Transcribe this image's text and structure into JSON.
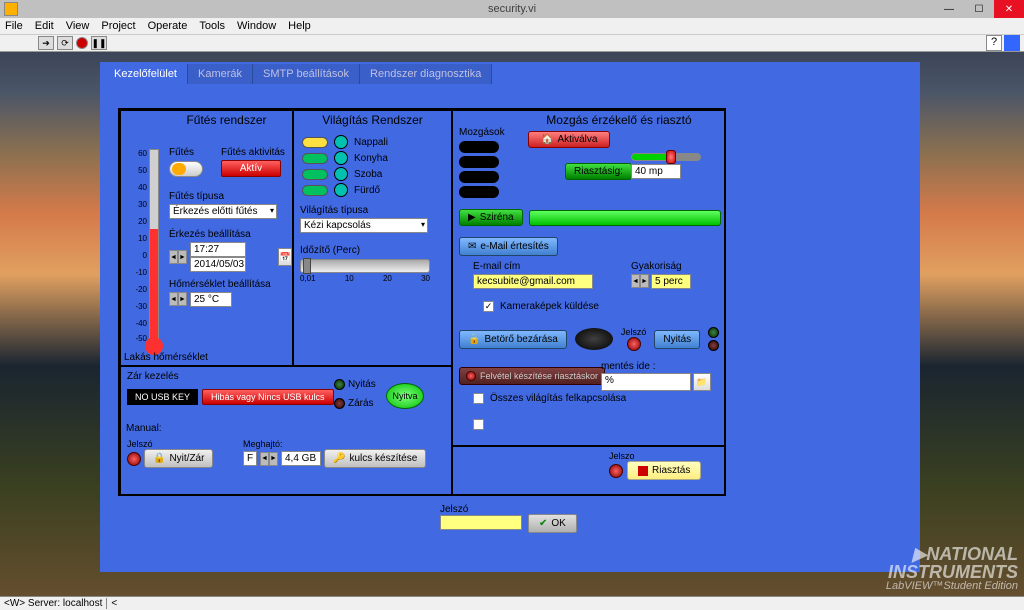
{
  "window": {
    "title": "security.vi"
  },
  "menu": [
    "File",
    "Edit",
    "View",
    "Project",
    "Operate",
    "Tools",
    "Window",
    "Help"
  ],
  "tabs": [
    "Kezelőfelület",
    "Kamerák",
    "SMTP beállítások",
    "Rendszer diagnosztika"
  ],
  "heating": {
    "title": "Fűtés rendszer",
    "futes_label": "Fűtés",
    "aktivitas_label": "Fűtés aktivitás",
    "aktiv": "Aktív",
    "tipus_label": "Fűtés típusa",
    "tipus_value": "Érkezés előtti fűtés",
    "erkezes_label": "Érkezés beállítása",
    "erkezes_time": "17:27",
    "erkezes_date": "2014/05/03",
    "temp_label": "Hőmérséklet beállítása",
    "temp_value": "25 °C",
    "bottom_label": "Lakás hőmérséklet",
    "ticks": [
      "60",
      "50",
      "40",
      "30",
      "20",
      "10",
      "0",
      "-10",
      "-20",
      "-30",
      "-40",
      "-50"
    ]
  },
  "lighting": {
    "title": "Világítás Rendszer",
    "rooms": [
      "Nappali",
      "Konyha",
      "Szoba",
      "Fürdő"
    ],
    "colors": [
      "#ffe040",
      "#00c060",
      "#00c060",
      "#00c060"
    ],
    "led_colors": [
      "#00c0b0",
      "#00c0b0",
      "#00c0b0",
      "#00c0b0"
    ],
    "tipus_label": "Világítás típusa",
    "tipus_value": "Kézi kapcsolás",
    "timer_label": "Időzítő (Perc)",
    "timer_ticks": [
      "0,01",
      "10",
      "20",
      "30"
    ]
  },
  "motion": {
    "title": "Mozgás érzékelő és riasztó",
    "mozgasok": "Mozgások",
    "aktivalva": "Aktiválva",
    "riasztasig": "Riasztásig:",
    "riaszt_val": "40 mp",
    "sziren": "Sziréna",
    "email_btn": "e-Mail értesítés",
    "email_label": "E-mail cím",
    "email_value": "kecsubite@gmail.com",
    "gyak_label": "Gyakoriság",
    "gyak_value": "5 perc",
    "kamerak": "Kameraképek küldése",
    "betoro": "Betörő bezárása",
    "jelszo": "Jelszó",
    "nyitas": "Nyitás",
    "felvetel": "Felvétel készítése riasztáskor",
    "mentes_label": "mentés ide :",
    "mentes_value": "%",
    "osszes": "Összes világítás felkapcsolása"
  },
  "lock": {
    "title": "Zár kezelés",
    "nousb": "NO USB KEY",
    "hibas": "Hibás vagy Nincs USB kulcs",
    "nyitas": "Nyitás",
    "nyitva": "Nyitva",
    "zaras": "Zárás",
    "manual": "Manual:",
    "jelszo": "Jelszó",
    "nyitzar": "Nyit/Zár",
    "meghajto": "Meghajtó:",
    "meghajto_val": "F",
    "size": "4,4 GB",
    "kulcs": "kulcs készítése"
  },
  "save": {
    "jelszo": "Jelszo",
    "riasztas": "Riasztás"
  },
  "bottom": {
    "jelszo": "Jelszó",
    "ok": "OK"
  },
  "status": "<W> Server: localhost",
  "branding": {
    "line1": "NATIONAL",
    "line2": "INSTRUMENTS",
    "line3": "LabVIEW™Student Edition"
  }
}
